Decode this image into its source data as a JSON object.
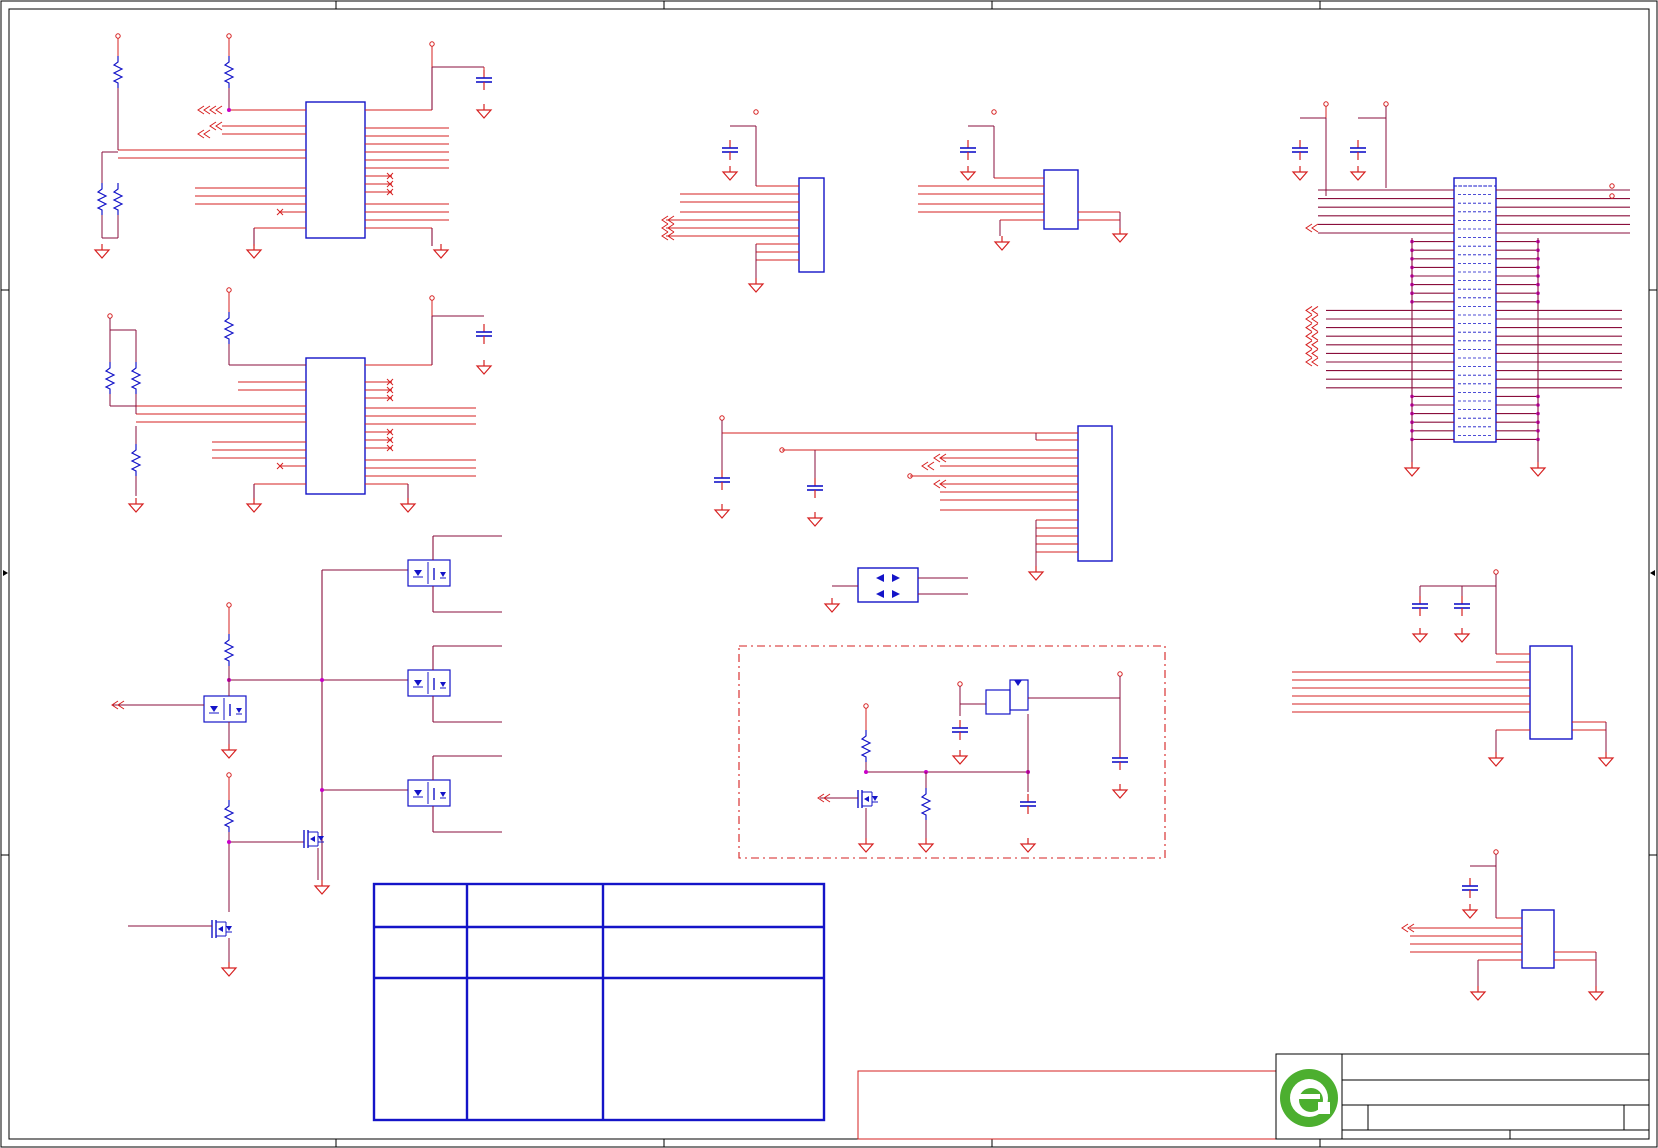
{
  "sheet": {
    "kind": "schematic",
    "title_block_text": [],
    "info_table": {
      "rows": 3,
      "cols": 3,
      "cells": []
    }
  },
  "colors": {
    "wire": "#d62020",
    "net": "#8a0f3c",
    "component": "#1414c8",
    "junction": "#c800c8",
    "frame": "#000000",
    "logo": "#4caf2f"
  },
  "icons": {
    "logo": "company-logo-icon",
    "ground": "ground-icon",
    "power": "power-port-icon",
    "resistor": "resistor-icon",
    "capacitor": "capacitor-icon",
    "ic": "ic-package-icon",
    "optocoupler": "optocoupler-icon",
    "mosfet": "mosfet-icon",
    "off_sheet": "off-sheet-connector-icon"
  }
}
